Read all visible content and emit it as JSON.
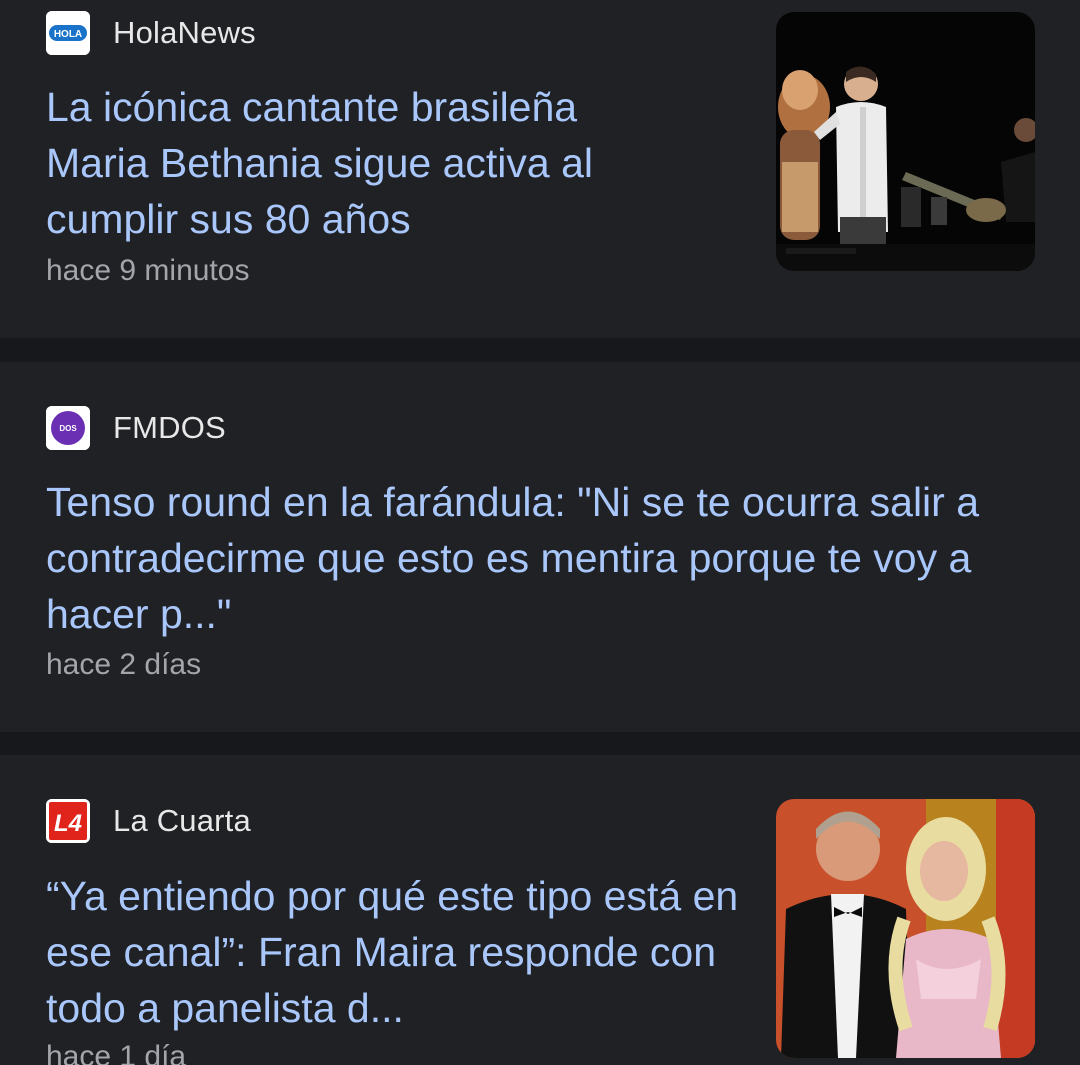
{
  "articles": [
    {
      "source": "HolaNews",
      "logo_text": "HOLA",
      "headline": "La icónica cantante brasileña Maria Bethania sigue activa al cumplir sus 80 años",
      "time": "hace 9 minutos",
      "logo_icon": "holanews-logo-icon",
      "thumbnail": "concert-singer-thumbnail"
    },
    {
      "source": "FMDOS",
      "logo_text": "DOS",
      "headline": "Tenso round en la farándula: \"Ni se te ocurra salir a contradecirme que esto es mentira porque te voy a hacer p...\"",
      "time": "hace 2 días",
      "logo_icon": "fmdos-logo-icon"
    },
    {
      "source": "La Cuarta",
      "logo_text": "L4",
      "headline": "“Ya entiendo por qué este tipo está en ese canal”: Fran Maira responde con todo a panelista d...",
      "time": "hace 1 día",
      "logo_icon": "lacuarta-logo-icon",
      "thumbnail": "couple-gala-thumbnail"
    }
  ],
  "colors": {
    "background": "#17181c",
    "card": "#202125",
    "headline": "#a9c7fa",
    "source": "#e8e8e8",
    "time": "#a3a5ab"
  }
}
